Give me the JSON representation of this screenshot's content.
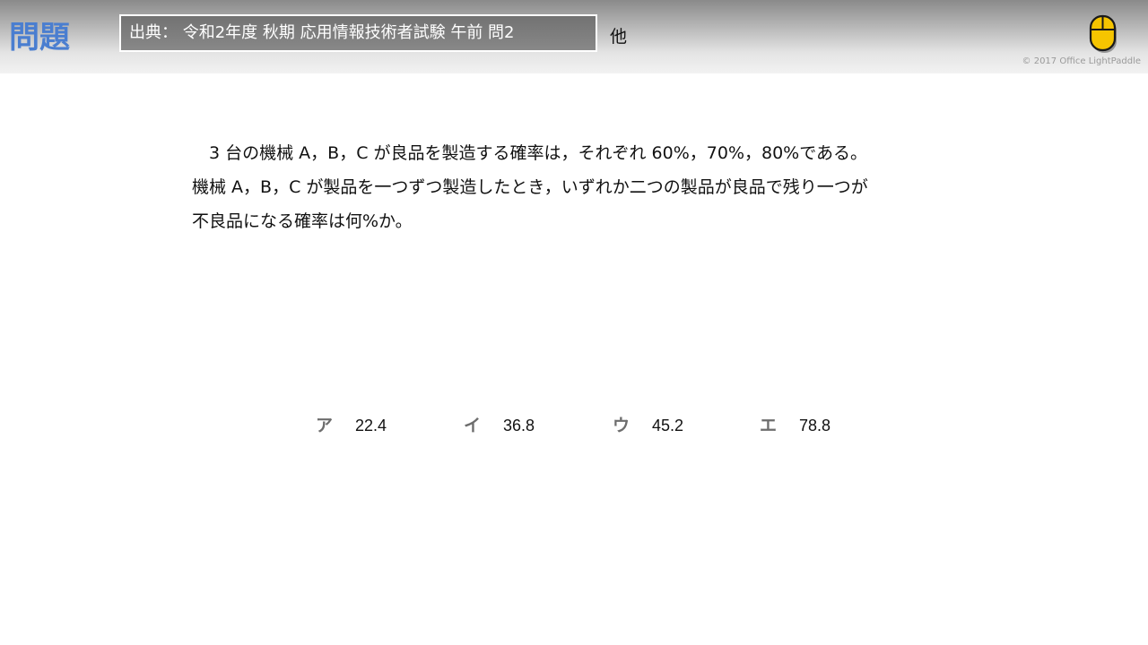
{
  "header": {
    "title": "問題",
    "source": "出典： 令和2年度 秋期 応用情報技術者試験 午前 問2",
    "source_extra": "他",
    "mouse_icon": "mouse-icon",
    "copyright": "© 2017 Office LightPaddle",
    "colors": {
      "title": "#4a7ed0",
      "mouse_body": "#f5c400",
      "source_bg": "#7c7c7c"
    }
  },
  "question": {
    "lines": [
      "　3 台の機械 A，B，C が良品を製造する確率は，それぞれ 60%，70%，80%である。",
      "機械 A，B，C が製品を一つずつ製造したとき，いずれか二つの製品が良品で残り一つが",
      "不良品になる確率は何%か。"
    ]
  },
  "choices": [
    {
      "mark": "ア",
      "value": "22.4"
    },
    {
      "mark": "イ",
      "value": "36.8"
    },
    {
      "mark": "ウ",
      "value": "45.2"
    },
    {
      "mark": "エ",
      "value": "78.8"
    }
  ]
}
